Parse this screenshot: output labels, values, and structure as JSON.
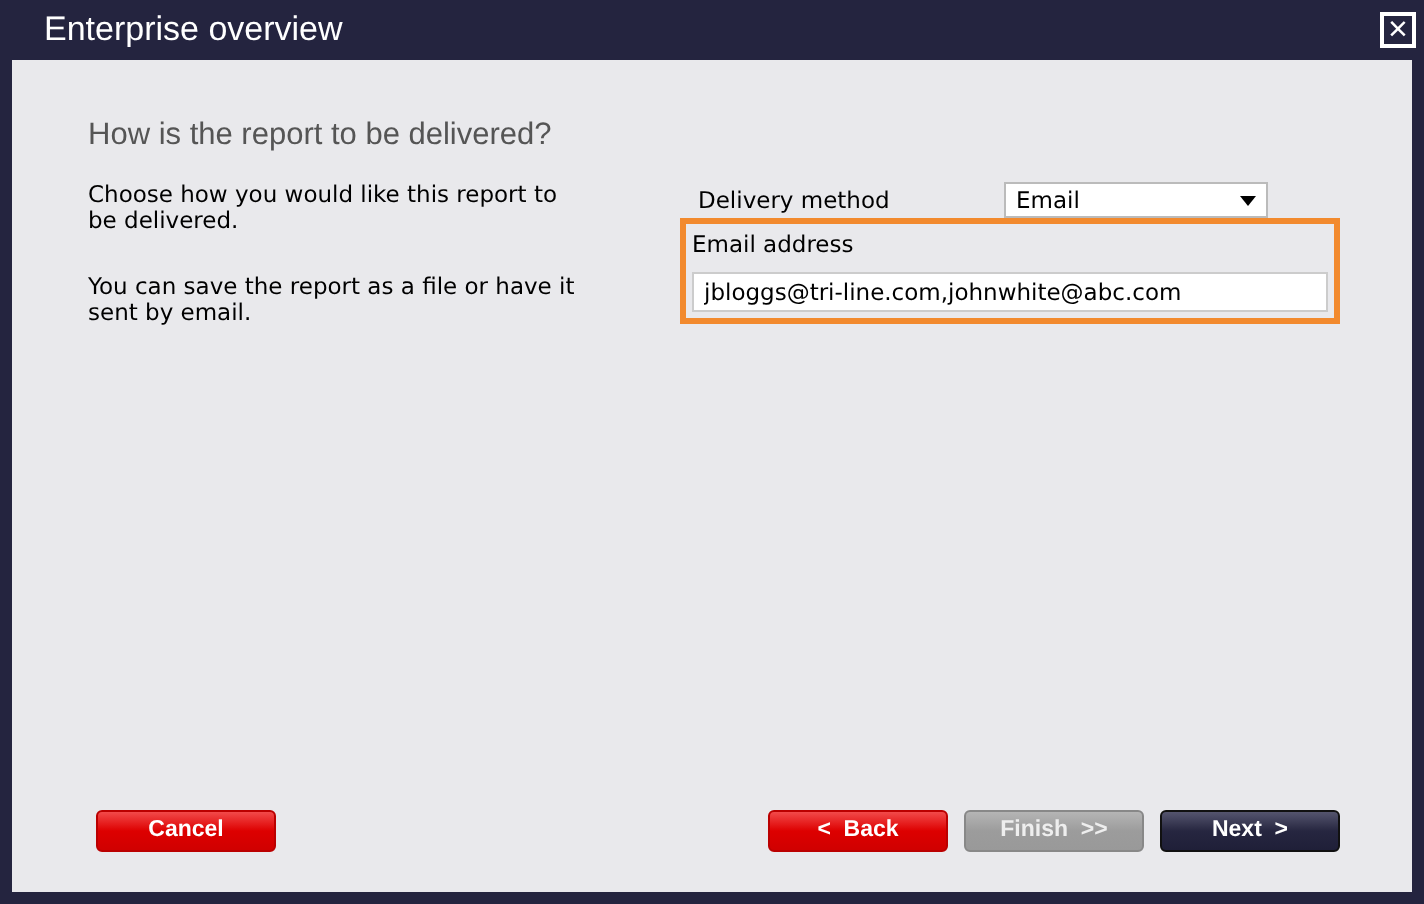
{
  "window": {
    "title": "Enterprise overview",
    "close": "×"
  },
  "heading": "How is the report to be delivered?",
  "description": [
    "Choose how you would like this report to be delivered.",
    "You can save the report as a file or have it sent by email."
  ],
  "delivery_method": {
    "label": "Delivery method",
    "value": "Email"
  },
  "email": {
    "label": "Email address",
    "value": "jbloggs@tri-line.com,johnwhite@abc.com",
    "highlighted": true
  },
  "buttons": [
    {
      "label": "Cancel",
      "kind": "danger",
      "disabled": false
    },
    {
      "label": "<  Back",
      "kind": "danger",
      "disabled": false
    },
    {
      "label": "Finish  >>",
      "kind": "muted",
      "disabled": true
    },
    {
      "label": "Next  >",
      "kind": "dark",
      "disabled": false
    }
  ]
}
